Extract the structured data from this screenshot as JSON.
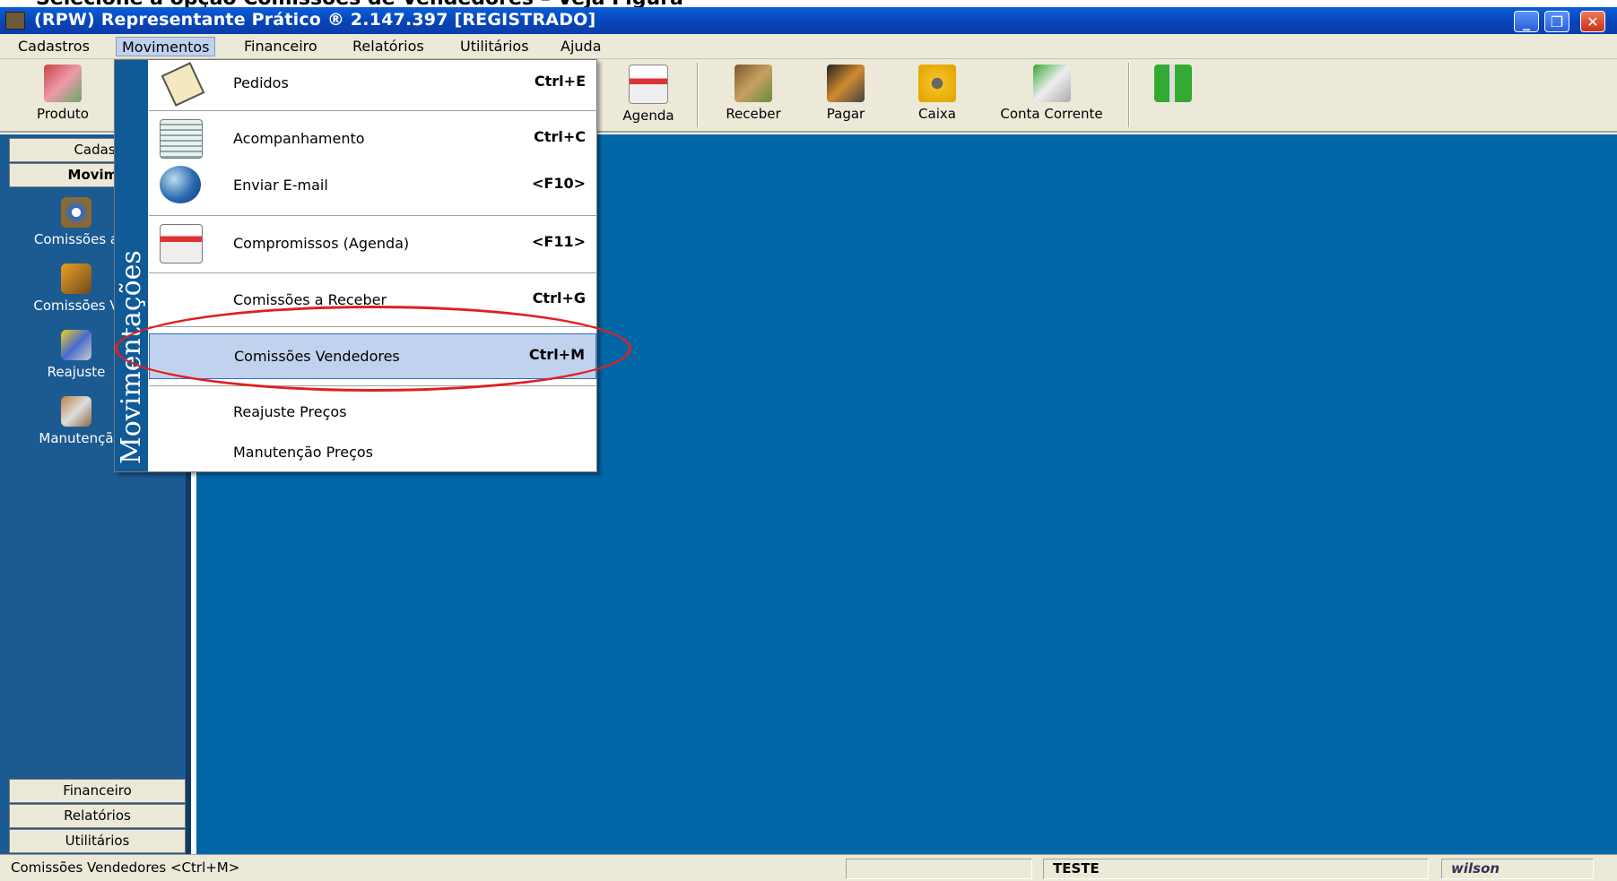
{
  "caption": "Selecione a opção Comissões de Vendedores – Veja Figura",
  "window": {
    "title": "(RPW) Representante Prático ® 2.147.397 [REGISTRADO]",
    "min_icon": "minimize-icon",
    "max_icon": "restore-icon",
    "close_icon": "close-icon"
  },
  "menubar": [
    "Cadastros",
    "Movimentos",
    "Financeiro",
    "Relatórios",
    "Utilitários",
    "Ajuda"
  ],
  "toolbar": {
    "left_label": "Produto",
    "items": [
      "Agenda",
      "Receber",
      "Pagar",
      "Caixa",
      "Conta Corrente"
    ]
  },
  "leftpanel": {
    "top_buttons": [
      "Cadast",
      "Movime"
    ],
    "items": [
      "Comissões a",
      "Comissões V",
      "Reajuste",
      "Manutençã"
    ],
    "bottom_buttons": [
      "Financeiro",
      "Relatórios",
      "Utilitários"
    ]
  },
  "dropdown": {
    "sidebar_title": "Movimentações",
    "items": [
      {
        "label": "Pedidos",
        "shortcut": "Ctrl+E",
        "icon": "clipboard-icon"
      },
      {
        "label": "Acompanhamento",
        "shortcut": "Ctrl+C",
        "icon": "document-icon"
      },
      {
        "label": "Enviar E-mail",
        "shortcut": "<F10>",
        "icon": "globe-icon"
      },
      {
        "label": "Compromissos (Agenda)",
        "shortcut": "<F11>",
        "icon": "calendar-icon"
      },
      {
        "label": "Comissões a Receber",
        "shortcut": "Ctrl+G"
      },
      {
        "label": "Comissões Vendedores",
        "shortcut": "Ctrl+M"
      },
      {
        "label": "Reajuste Preços",
        "shortcut": ""
      },
      {
        "label": "Manutenção Preços",
        "shortcut": ""
      }
    ]
  },
  "statusbar": {
    "message": "Comissões Vendedores <Ctrl+M>",
    "company": "TESTE",
    "user": "wilson"
  },
  "colors": {
    "workspace": "#0066a6",
    "highlight": "#c1d2ee",
    "annotation": "#e02020"
  }
}
